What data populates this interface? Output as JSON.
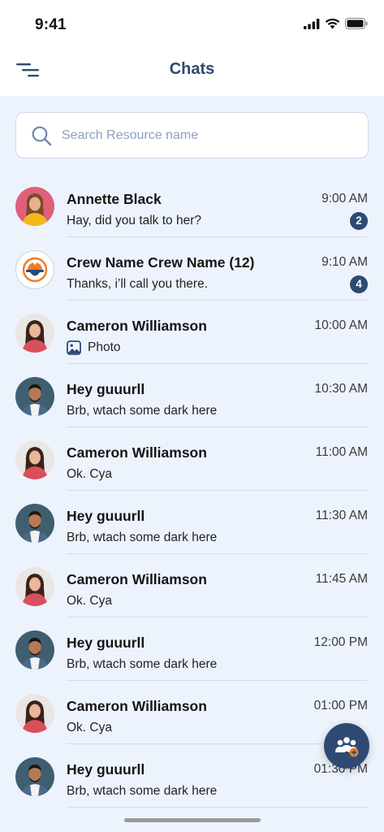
{
  "status_bar": {
    "time": "9:41"
  },
  "header": {
    "title": "Chats"
  },
  "search": {
    "placeholder": "Search Resource name"
  },
  "colors": {
    "accent": "#2e4a73",
    "background": "#edf3fd",
    "badge": "#2e4a73",
    "fab_plus": "#f07c28"
  },
  "fab": {
    "icon": "group-add-icon"
  },
  "chats": [
    {
      "name": "Annette Black",
      "message": "Hay, did you talk to her?",
      "time": "9:00 AM",
      "unread": "2",
      "avatar": "woman-yellow"
    },
    {
      "name": "Crew Name Crew Name (12)",
      "message": "Thanks, i’ll call you there.",
      "time": "9:10 AM",
      "unread": "4",
      "avatar": "crew-logo"
    },
    {
      "name": "Cameron Williamson",
      "message": "Photo",
      "time": "10:00 AM",
      "attachment": "photo-icon",
      "avatar": "woman-red"
    },
    {
      "name": "Hey guuurll",
      "message": "Brb, wtach some dark here",
      "time": "10:30 AM",
      "avatar": "man"
    },
    {
      "name": "Cameron Williamson",
      "message": "Ok. Cya",
      "time": "11:00 AM",
      "avatar": "woman-red"
    },
    {
      "name": "Hey guuurll",
      "message": "Brb, wtach some dark here",
      "time": "11:30 AM",
      "avatar": "man"
    },
    {
      "name": "Cameron Williamson",
      "message": "Ok. Cya",
      "time": "11:45 AM",
      "avatar": "woman-red"
    },
    {
      "name": "Hey guuurll",
      "message": "Brb, wtach some dark here",
      "time": "12:00 PM",
      "avatar": "man"
    },
    {
      "name": "Cameron Williamson",
      "message": "Ok. Cya",
      "time": "01:00 PM",
      "avatar": "woman-red"
    },
    {
      "name": "Hey guuurll",
      "message": "Brb, wtach some dark here",
      "time": "01:30 PM",
      "avatar": "man"
    }
  ]
}
